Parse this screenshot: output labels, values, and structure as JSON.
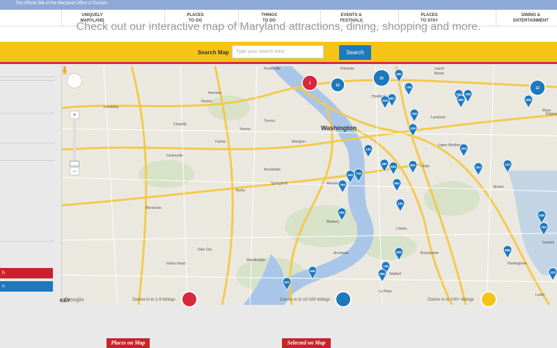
{
  "site": {
    "tagline": "The Official Site of the Maryland Office of Tourism"
  },
  "nav": [
    {
      "line1": "UNIQUELY",
      "line2": "MARYLAND"
    },
    {
      "line1": "PLACES",
      "line2": "TO GO"
    },
    {
      "line1": "THINGS",
      "line2": "TO DO"
    },
    {
      "line1": "EVENTS &",
      "line2": "FESTIVALS"
    },
    {
      "line1": "PLACES",
      "line2": "TO STAY"
    },
    {
      "line1": "DINING &",
      "line2": "ENTERTAINMENT"
    }
  ],
  "heading": "Check out our interactive map of Maryland attractions, dining, shopping and more.",
  "search": {
    "label": "Search Map",
    "placeholder": "Type your search here",
    "button": "Search"
  },
  "map": {
    "google_label": "Google",
    "city_label": "Washington",
    "place_labels": [
      "Poolesville",
      "Potomac",
      "Laurel",
      "Bowie",
      "Herndon",
      "Reston",
      "Vienna",
      "Tysons",
      "Arlington",
      "Alexandria",
      "Fairfax",
      "Annandale",
      "Springfield",
      "Burke",
      "Centreville",
      "Manassas",
      "Dale City",
      "Woodbridge",
      "Waldorf",
      "Clinton",
      "Upper Marlboro",
      "Hyattsville",
      "Largo",
      "Landover",
      "Chantilly",
      "Leesburg",
      "Accokeek",
      "Indian Head",
      "Bristol",
      "Dunkirk",
      "Huntingtown",
      "Lusby",
      "Mayo",
      "Edgewater",
      "Marbury",
      "Brandywine",
      "La Plata"
    ],
    "markers": [
      {
        "label": "1",
        "color": "#d9283d"
      },
      {
        "label": "12",
        "color": "#1e78be"
      },
      {
        "label": "16",
        "color": "#1e78be"
      },
      {
        "label": "12",
        "color": "#1e78be"
      },
      {
        "label": "490",
        "color": "#1e78be"
      },
      {
        "label": "726",
        "color": "#1e78be"
      },
      {
        "label": "467",
        "color": "#1e78be"
      },
      {
        "label": "516",
        "color": "#1e78be"
      },
      {
        "label": "706",
        "color": "#1e78be"
      },
      {
        "label": "228",
        "color": "#1e78be"
      },
      {
        "label": "413",
        "color": "#1e78be"
      },
      {
        "label": "890",
        "color": "#1e78be"
      },
      {
        "label": "108",
        "color": "#1e78be"
      },
      {
        "label": "806",
        "color": "#1e78be"
      },
      {
        "label": "130",
        "color": "#1e78be"
      },
      {
        "label": "333",
        "color": "#1e78be"
      },
      {
        "label": "482",
        "color": "#1e78be"
      },
      {
        "label": "844",
        "color": "#1e78be"
      },
      {
        "label": "801",
        "color": "#1e78be"
      },
      {
        "label": "302",
        "color": "#1e78be"
      },
      {
        "label": "132",
        "color": "#1e78be"
      },
      {
        "label": "728",
        "color": "#1e78be"
      },
      {
        "label": "183",
        "color": "#1e78be"
      },
      {
        "label": "764",
        "color": "#1e78be"
      },
      {
        "label": "893",
        "color": "#1e78be"
      },
      {
        "label": "184",
        "color": "#1e78be"
      },
      {
        "label": "606",
        "color": "#1e78be"
      },
      {
        "label": "539",
        "color": "#1e78be"
      },
      {
        "label": "763",
        "color": "#1e78be"
      },
      {
        "label": "668",
        "color": "#1e78be"
      },
      {
        "label": "509",
        "color": "#1e78be"
      },
      {
        "label": "849",
        "color": "#1e78be"
      },
      {
        "label": "746",
        "color": "#1e78be"
      },
      {
        "label": "856",
        "color": "#1e78be"
      },
      {
        "label": "531",
        "color": "#1e78be"
      },
      {
        "label": "123",
        "color": "#1e78be"
      }
    ]
  },
  "key": {
    "title": "KEY",
    "items": [
      {
        "text": "Zooms in to 1-9 listings",
        "color": "#d9283d"
      },
      {
        "text": "Zooms in to 10-100 listings",
        "color": "#1e78be"
      },
      {
        "text": "Zooms in to 100+ listings",
        "color": "#f5c416"
      }
    ]
  },
  "tabs": {
    "places_on_map": "Places on Map",
    "selected_on_map": "Selected on Map"
  },
  "left_panel": {
    "btn_red": "h",
    "btn_blue": "n"
  }
}
